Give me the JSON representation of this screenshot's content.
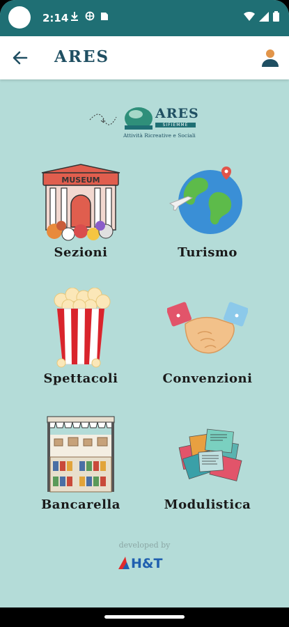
{
  "status_bar": {
    "time": "2:14"
  },
  "app_bar": {
    "title": "ARES"
  },
  "logo": {
    "word": "ARES",
    "sub": "SIFIEMME",
    "tagline": "Attività Ricreative e Sociali"
  },
  "menu": [
    {
      "label": "Sezioni",
      "icon": "museum-icon"
    },
    {
      "label": "Turismo",
      "icon": "globe-icon"
    },
    {
      "label": "Spettacoli",
      "icon": "popcorn-icon"
    },
    {
      "label": "Convenzioni",
      "icon": "handshake-icon"
    },
    {
      "label": "Bancarella",
      "icon": "market-stall-icon"
    },
    {
      "label": "Modulistica",
      "icon": "forms-icon"
    }
  ],
  "footer": {
    "developed_by": "developed by",
    "brand": "H&T"
  },
  "colors": {
    "background": "#b4dcd8",
    "status_bar": "#1f6f74",
    "title": "#1f4f62"
  }
}
